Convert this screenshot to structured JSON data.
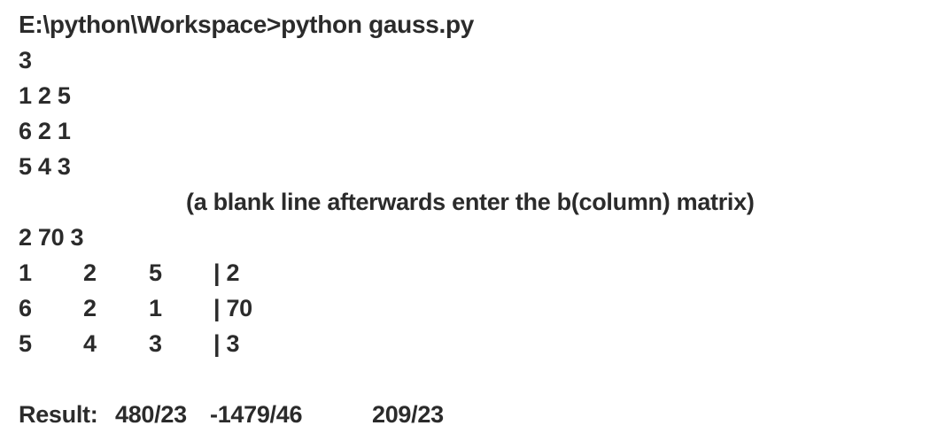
{
  "terminal": {
    "command": "E:\\python\\Workspace>python gauss.py",
    "n": "3",
    "input_rows": [
      "1 2 5",
      "6 2 1",
      "5 4 3"
    ],
    "note": "(a blank line afterwards enter the b(column) matrix)",
    "b_input": "2 70 3",
    "augmented_matrix": [
      [
        "1",
        "2",
        "5",
        "| 2"
      ],
      [
        "6",
        "2",
        "1",
        "| 70"
      ],
      [
        "5",
        "4",
        "3",
        "| 3"
      ]
    ],
    "result": {
      "label": "Result:",
      "values": [
        "480/23",
        "-1479/46",
        "209/23"
      ]
    }
  }
}
